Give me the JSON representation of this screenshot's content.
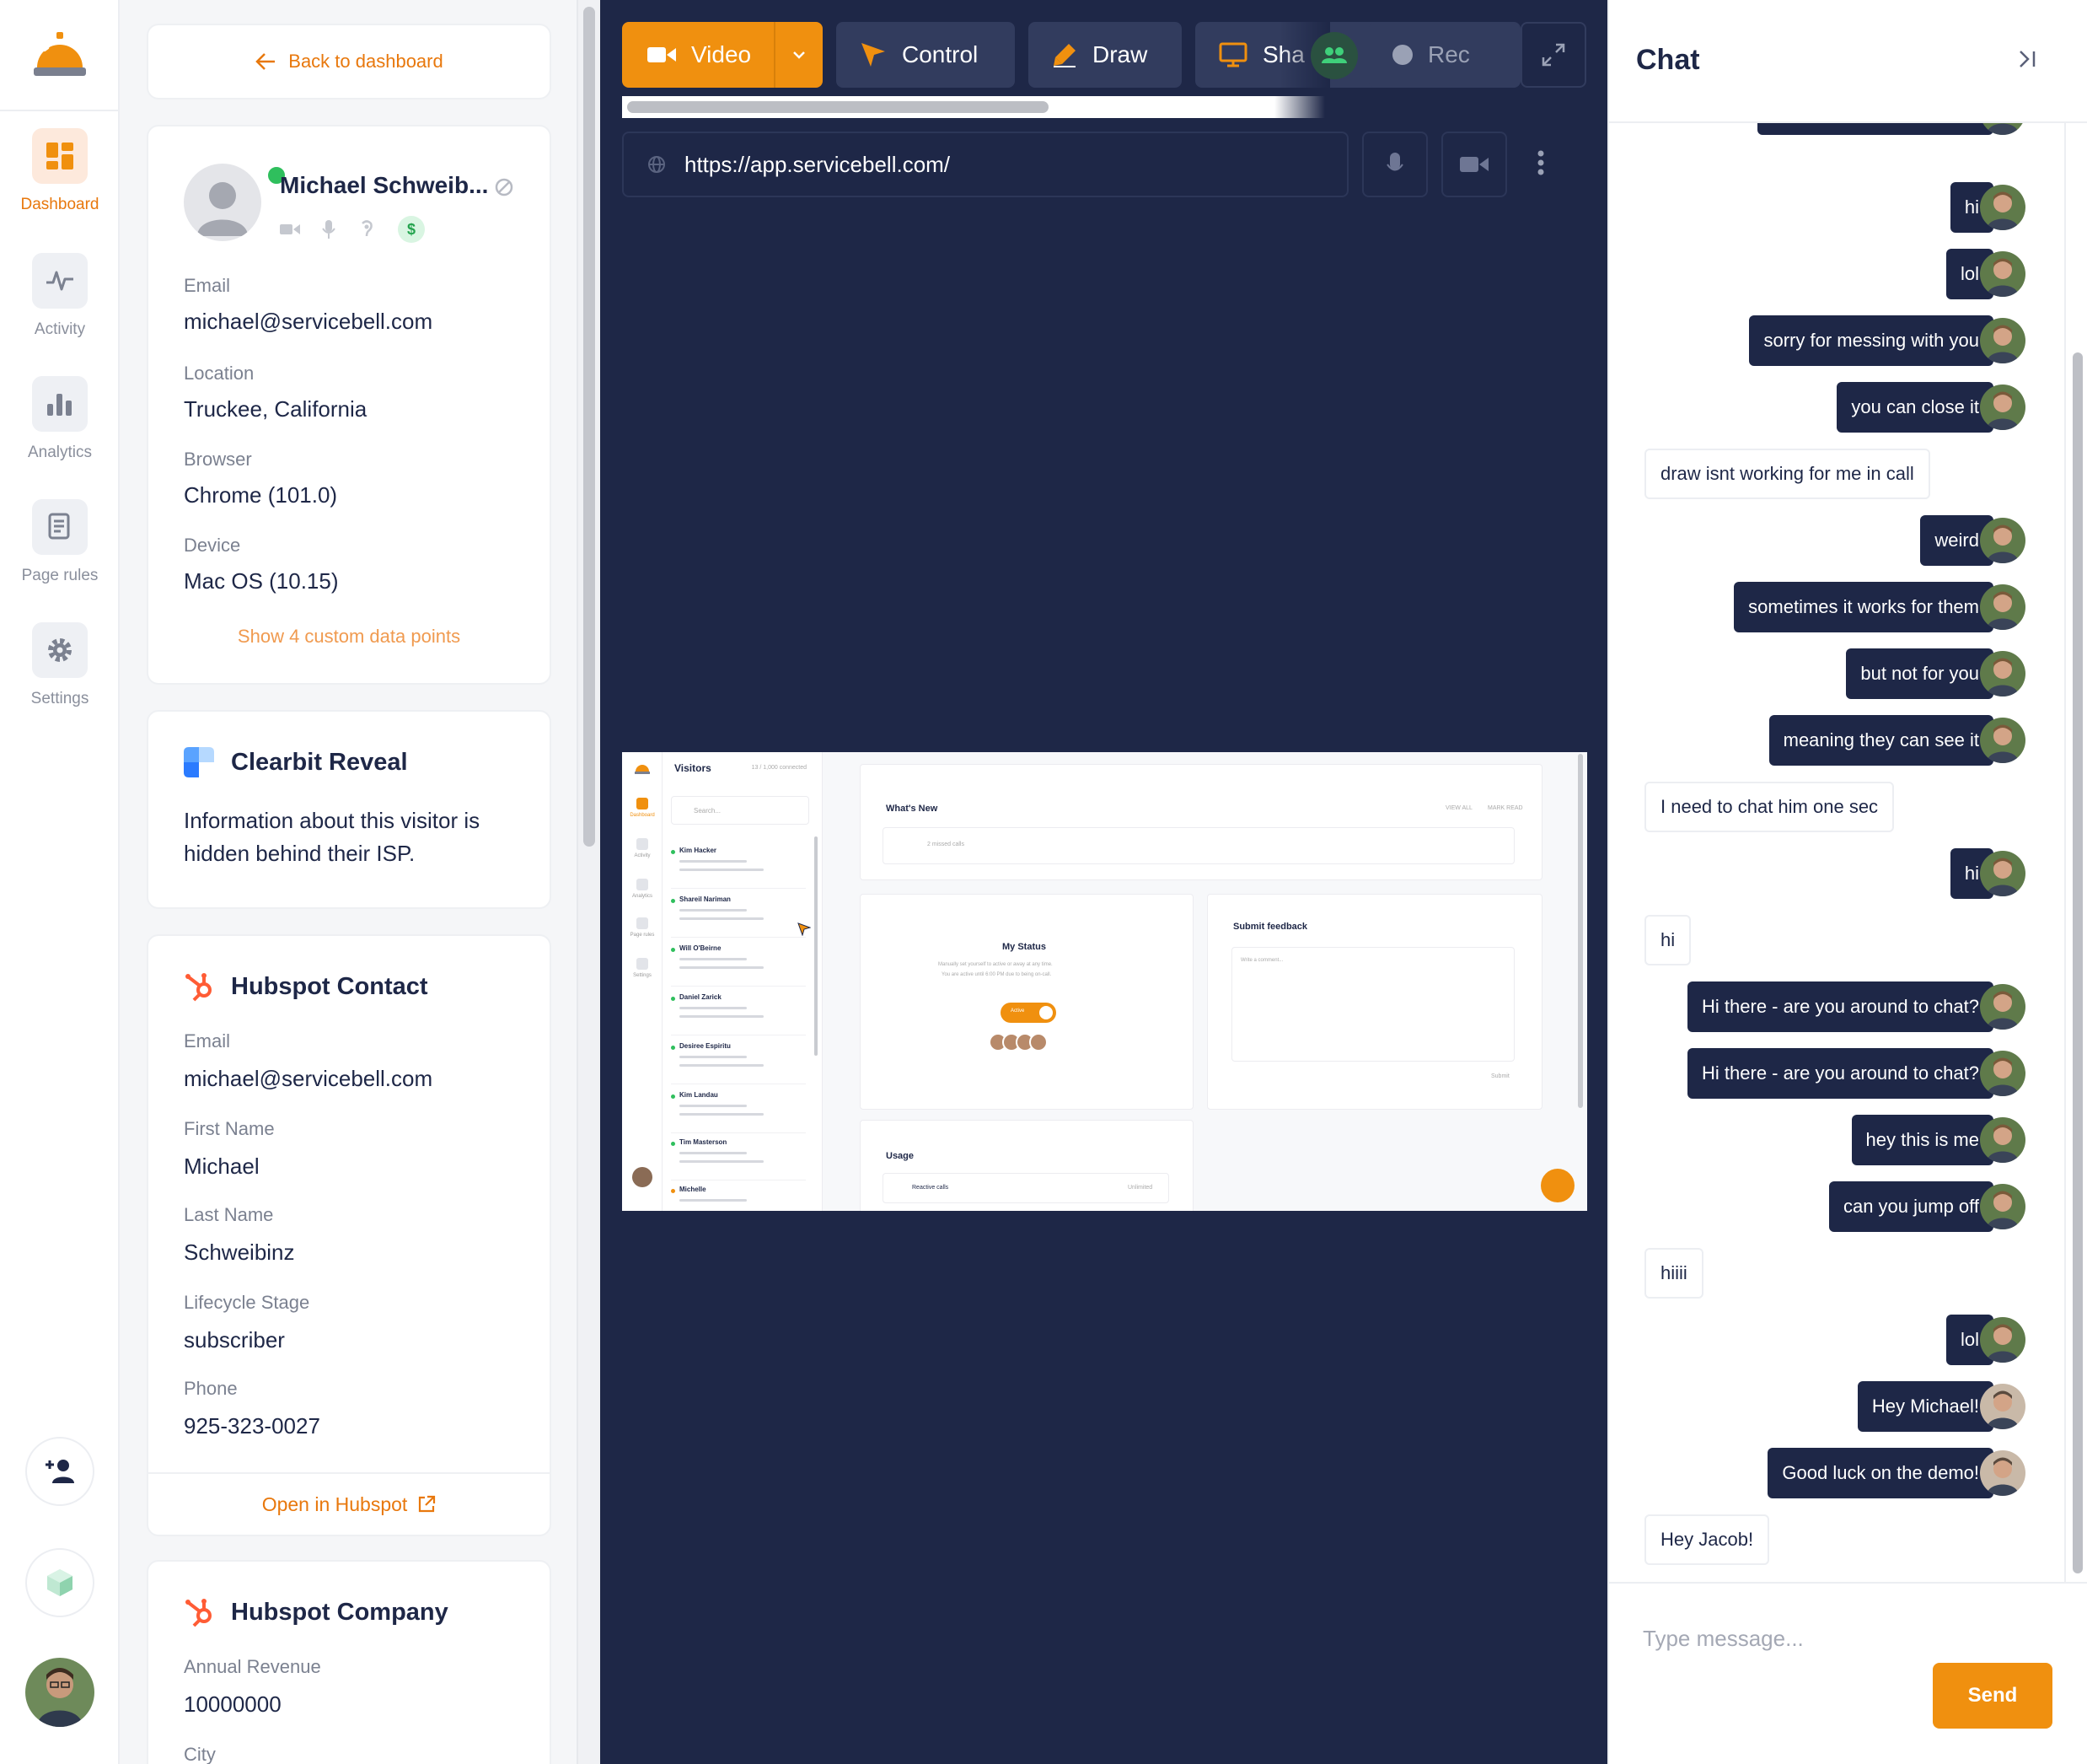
{
  "nav": {
    "items": [
      {
        "label": "Dashboard",
        "icon": "dashboard-icon"
      },
      {
        "label": "Activity",
        "icon": "activity-icon"
      },
      {
        "label": "Analytics",
        "icon": "analytics-icon"
      },
      {
        "label": "Page rules",
        "icon": "page-rules-icon"
      },
      {
        "label": "Settings",
        "icon": "gear-icon"
      }
    ],
    "active": "Dashboard"
  },
  "visitor": {
    "back_label": "Back to dashboard",
    "name": "Michael Schweib...",
    "status": "online",
    "fields": [
      {
        "label": "Email",
        "value": "michael@servicebell.com"
      },
      {
        "label": "Location",
        "value": "Truckee, California"
      },
      {
        "label": "Browser",
        "value": "Chrome (101.0)"
      },
      {
        "label": "Device",
        "value": "Mac OS (10.15)"
      }
    ],
    "show_more": "Show 4 custom data points"
  },
  "clearbit": {
    "title": "Clearbit Reveal",
    "text": "Information about this visitor is hidden behind their ISP."
  },
  "hubspot_contact": {
    "title": "Hubspot Contact",
    "fields": [
      {
        "label": "Email",
        "value": "michael@servicebell.com"
      },
      {
        "label": "First Name",
        "value": "Michael"
      },
      {
        "label": "Last Name",
        "value": "Schweibinz"
      },
      {
        "label": "Lifecycle Stage",
        "value": "subscriber"
      },
      {
        "label": "Phone",
        "value": "925-323-0027"
      }
    ],
    "open_label": "Open in Hubspot"
  },
  "hubspot_company": {
    "title": "Hubspot Company",
    "fields": [
      {
        "label": "Annual Revenue",
        "value": "10000000"
      },
      {
        "label": "City",
        "value": ""
      }
    ]
  },
  "toolbar": {
    "video": "Video",
    "control": "Control",
    "draw": "Draw",
    "share": "Sha",
    "rec": "Rec"
  },
  "browser": {
    "url": "https://app.servicebell.com/"
  },
  "remote": {
    "visitors_title": "Visitors",
    "connected": "13 / 1,000 connected",
    "search_placeholder": "Search...",
    "visitors": [
      "Kim Hacker",
      "Shareil Nariman",
      "Will O'Beirne",
      "Daniel Zarick",
      "Desiree Espiritu",
      "Kim Landau",
      "Tim Masterson",
      "Michelle"
    ],
    "whats_new": "What's New",
    "view_all": "VIEW ALL",
    "mark_read": "MARK READ",
    "missed": "2 missed calls",
    "my_status": "My Status",
    "status_desc": "Manually set yourself to active or away at any time.",
    "status_desc2": "You are active until 6:00 PM due to being on-call.",
    "active": "Active",
    "feedback": "Submit feedback",
    "feedback_placeholder": "Write a comment...",
    "submit": "Submit",
    "usage": "Usage",
    "reactive_calls": "Reactive calls",
    "unlimited": "Unlimited",
    "nav_labels": [
      "Dashboard",
      "Activity",
      "Analytics",
      "Page rules",
      "Settings"
    ]
  },
  "chat": {
    "title": "Chat",
    "messages": [
      {
        "dir": "out",
        "text": "hi",
        "avatar": "agent"
      },
      {
        "dir": "out",
        "text": "lol",
        "avatar": "agent"
      },
      {
        "dir": "out",
        "text": "sorry for messing with you",
        "avatar": "agent"
      },
      {
        "dir": "out",
        "text": "you can close it",
        "avatar": "agent"
      },
      {
        "dir": "in",
        "text": "draw isnt working for me in call"
      },
      {
        "dir": "out",
        "text": "weird",
        "avatar": "agent"
      },
      {
        "dir": "out",
        "text": "sometimes it works for them",
        "avatar": "agent"
      },
      {
        "dir": "out",
        "text": "but not for you",
        "avatar": "agent"
      },
      {
        "dir": "out",
        "text": "meaning they can see it",
        "avatar": "agent"
      },
      {
        "dir": "in",
        "text": "I need to chat him one sec"
      },
      {
        "dir": "out",
        "text": "hi",
        "avatar": "agent"
      },
      {
        "dir": "in",
        "text": "hi"
      },
      {
        "dir": "out",
        "text": "Hi there - are you around to chat?",
        "avatar": "agent"
      },
      {
        "dir": "out",
        "text": "Hi there - are you around to chat?",
        "avatar": "agent"
      },
      {
        "dir": "out",
        "text": "hey this is me",
        "avatar": "agent"
      },
      {
        "dir": "out",
        "text": "can you jump off",
        "avatar": "agent"
      },
      {
        "dir": "in",
        "text": "hiiii"
      },
      {
        "dir": "out",
        "text": "lol",
        "avatar": "agent"
      },
      {
        "dir": "out",
        "text": "Hey Michael!",
        "avatar": "agent2"
      },
      {
        "dir": "out",
        "text": "Good luck on the demo!",
        "avatar": "agent2"
      },
      {
        "dir": "in",
        "text": "Hey Jacob!"
      }
    ],
    "input_placeholder": "Type message...",
    "send_label": "Send"
  },
  "colors": {
    "accent": "#f0900f",
    "navy": "#1e2747",
    "online": "#2fbf5d"
  }
}
